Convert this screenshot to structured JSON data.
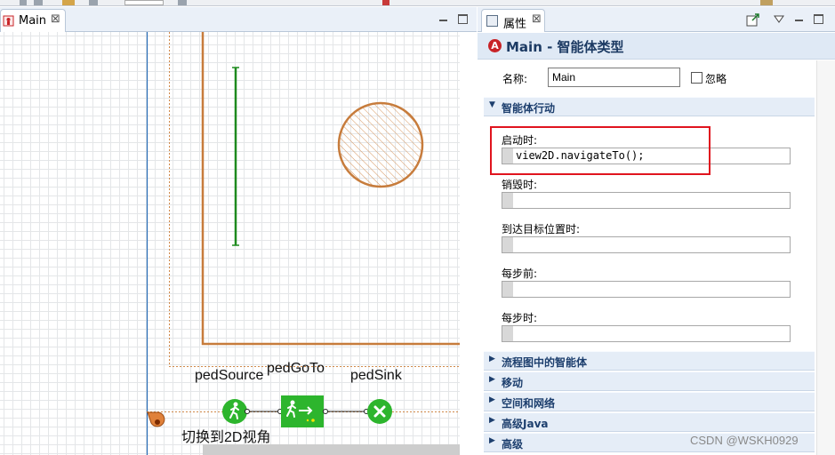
{
  "editor": {
    "tab_label": "Main",
    "tab_close": "⊠"
  },
  "canvas": {
    "agents": {
      "ped_source_label": "pedSource",
      "ped_goto_label": "pedGoTo",
      "ped_sink_label": "pedSink"
    },
    "view_area_label": "切换到2D视角"
  },
  "properties": {
    "tab_label": "属性",
    "tab_close": "⊠",
    "header_title": "Main - 智能体类型",
    "name_label": "名称:",
    "name_value": "Main",
    "ignore_label": "忽略",
    "sections": {
      "agent_actions": "智能体行动",
      "flowchart_agents": "流程图中的智能体",
      "movement": "移动",
      "space_network": "空间和网络",
      "advanced_java": "高级Java",
      "advanced": "高级"
    },
    "actions": [
      {
        "label": "启动时:",
        "code": "view2D.navigateTo();"
      },
      {
        "label": "销毁时:",
        "code": ""
      },
      {
        "label": "到达目标位置时:",
        "code": ""
      },
      {
        "label": "每步前:",
        "code": ""
      },
      {
        "label": "每步时:",
        "code": ""
      }
    ]
  },
  "watermark": "CSDN @WSKH0929",
  "colors": {
    "accent": "#1c3a63",
    "wall": "#c77c3c",
    "line_green": "#1e8a1e",
    "agent_green": "#2db52d",
    "highlight": "#e0141e"
  }
}
